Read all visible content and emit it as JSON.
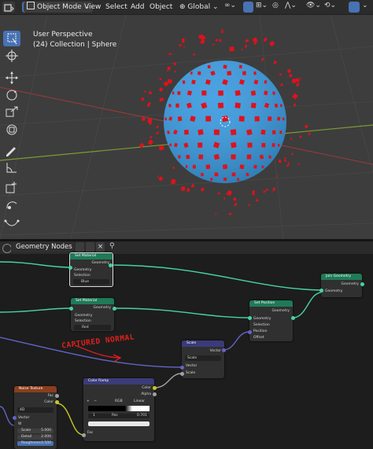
{
  "topbar": {
    "mode": "Object Mode",
    "menu": [
      "View",
      "Select",
      "Add",
      "Object"
    ],
    "transform_orientation": "Global"
  },
  "viewport": {
    "title": "User Perspective",
    "subtitle": "(24) Collection | Sphere"
  },
  "node_editor": {
    "name": "Geometry Nodes",
    "annotation": "CAPTURED NORMAL",
    "nodes": {
      "set_material_top": {
        "title": "Set Material",
        "out": "Geometry",
        "in_geometry": "Geometry",
        "selection": "Selection",
        "material": "Blue"
      },
      "set_material": {
        "title": "Set Material",
        "out": "Geometry",
        "in_geometry": "Geometry",
        "selection": "Selection",
        "material": "Red"
      },
      "set_position": {
        "title": "Set Position",
        "out": "Geometry",
        "in_geometry": "Geometry",
        "selection": "Selection",
        "position": "Position",
        "offset": "Offset"
      },
      "join_geometry": {
        "title": "Join Geometry",
        "out": "Geometry",
        "in": "Geometry"
      },
      "scale": {
        "title": "Scale",
        "out": "Vector",
        "mode": "Scale",
        "vector": "Vector",
        "scale": "Scale"
      },
      "color_ramp": {
        "title": "Color Ramp",
        "out_color": "Color",
        "out_alpha": "Alpha",
        "mode": "RGB",
        "interp": "Linear",
        "index": "1",
        "pos_label": "Pos",
        "pos_value": "0.701",
        "fac": "Fac"
      },
      "noise": {
        "title": "Noise Texture",
        "out_fac": "Fac",
        "out_color": "Color",
        "dim": "4D",
        "vector": "Vector",
        "w": "W",
        "scale_l": "Scale",
        "scale_v": "5.000",
        "detail_l": "Detail",
        "detail_v": "2.000",
        "rough_l": "Roughness",
        "rough_v": "0.500"
      }
    }
  },
  "colors": {
    "sphere": "#3a9be0",
    "patch": "#e0111b",
    "geometry_link": "#46d3a3",
    "vector_link": "#6363c7",
    "float_link": "#a1a1a1",
    "color_link": "#c7c729",
    "annotation": "#e0201c"
  },
  "icons": [
    "select-box-icon",
    "cursor-icon",
    "move-icon",
    "rotate-icon",
    "scale-icon",
    "transform-icon",
    "annotate-icon",
    "measure-icon",
    "add-cube-icon",
    "spin-icon",
    "curve-icon",
    "pin-icon"
  ]
}
